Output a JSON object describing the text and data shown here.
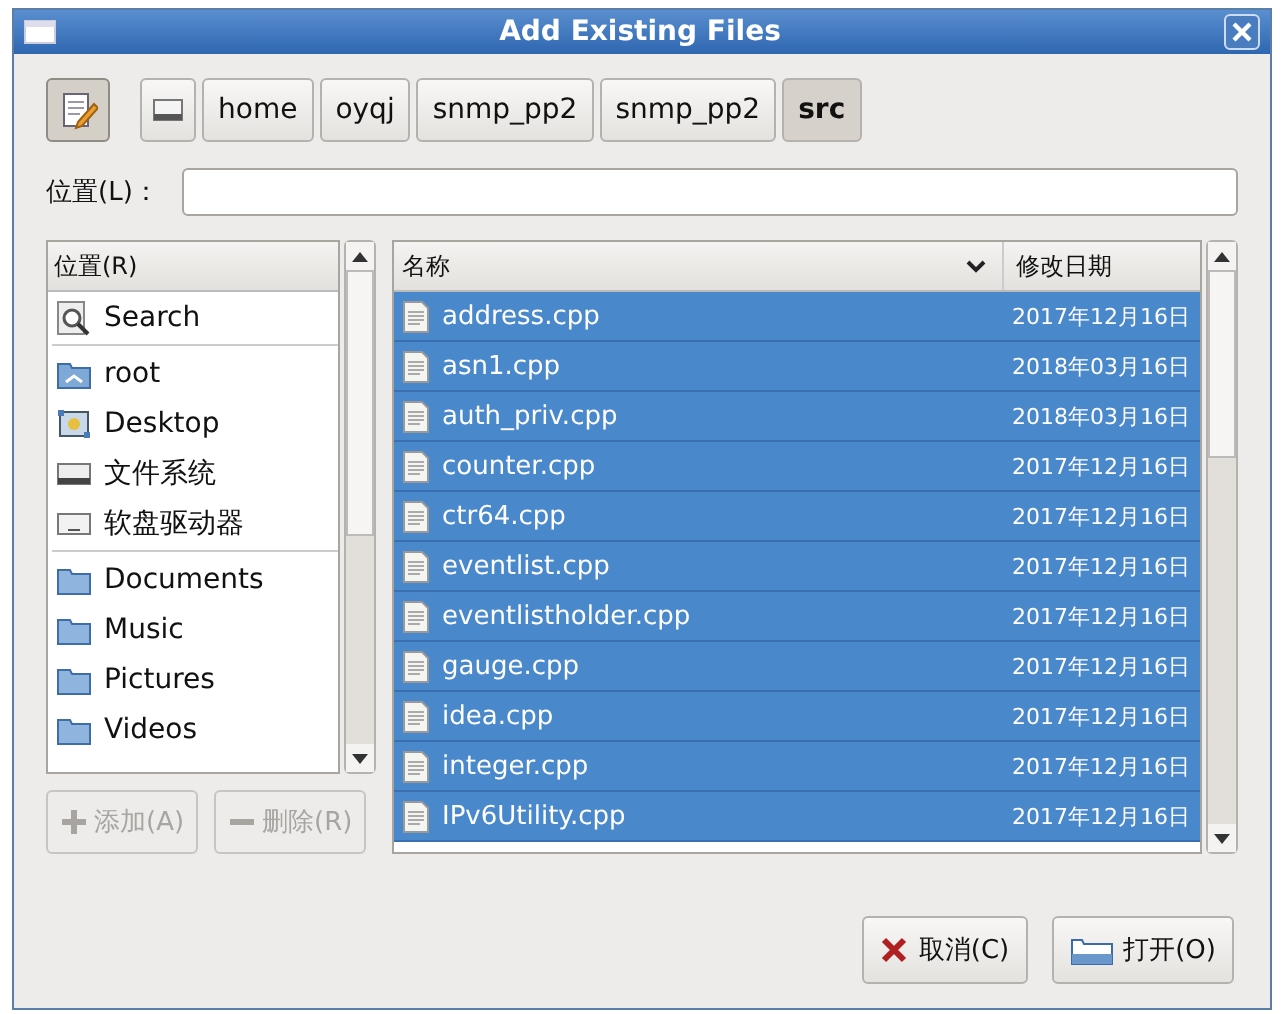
{
  "window": {
    "title": "Add Existing Files"
  },
  "path_bar": {
    "edit_toggle": {
      "on": true
    },
    "crumbs": [
      {
        "label": "home",
        "selected": false
      },
      {
        "label": "oyqj",
        "selected": false
      },
      {
        "label": "snmp_pp2",
        "selected": false
      },
      {
        "label": "snmp_pp2",
        "selected": false
      },
      {
        "label": "src",
        "selected": true
      }
    ]
  },
  "location": {
    "label": "位置(L)："
  },
  "sidebar": {
    "header": "位置(R)",
    "sections": [
      [
        {
          "label": "Search",
          "kind": "search"
        }
      ],
      [
        {
          "label": "root",
          "kind": "home"
        },
        {
          "label": "Desktop",
          "kind": "desktop"
        },
        {
          "label": "文件系统",
          "kind": "drive"
        },
        {
          "label": "软盘驱动器",
          "kind": "floppy"
        }
      ],
      [
        {
          "label": "Documents",
          "kind": "folder"
        },
        {
          "label": "Music",
          "kind": "folder"
        },
        {
          "label": "Pictures",
          "kind": "folder"
        },
        {
          "label": "Videos",
          "kind": "folder"
        }
      ]
    ],
    "buttons": [
      {
        "label": "添加(A)",
        "kind": "add",
        "disabled": true
      },
      {
        "label": "删除(R)",
        "kind": "remove",
        "disabled": true
      }
    ]
  },
  "files": {
    "columns": [
      "名称",
      "修改日期"
    ],
    "rows": [
      {
        "name": "address.cpp",
        "date": "2017年12月16日",
        "selected": true
      },
      {
        "name": "asn1.cpp",
        "date": "2018年03月16日",
        "selected": true
      },
      {
        "name": "auth_priv.cpp",
        "date": "2018年03月16日",
        "selected": true
      },
      {
        "name": "counter.cpp",
        "date": "2017年12月16日",
        "selected": true
      },
      {
        "name": "ctr64.cpp",
        "date": "2017年12月16日",
        "selected": true
      },
      {
        "name": "eventlist.cpp",
        "date": "2017年12月16日",
        "selected": true
      },
      {
        "name": "eventlistholder.cpp",
        "date": "2017年12月16日",
        "selected": true
      },
      {
        "name": "gauge.cpp",
        "date": "2017年12月16日",
        "selected": true
      },
      {
        "name": "idea.cpp",
        "date": "2017年12月16日",
        "selected": true
      },
      {
        "name": "integer.cpp",
        "date": "2017年12月16日",
        "selected": true
      },
      {
        "name": "IPv6Utility.cpp",
        "date": "2017年12月16日",
        "selected": true
      }
    ]
  },
  "buttons": [
    {
      "label": "取消(C)",
      "kind": "cancel"
    },
    {
      "label": "打开(O)",
      "kind": "open"
    }
  ]
}
